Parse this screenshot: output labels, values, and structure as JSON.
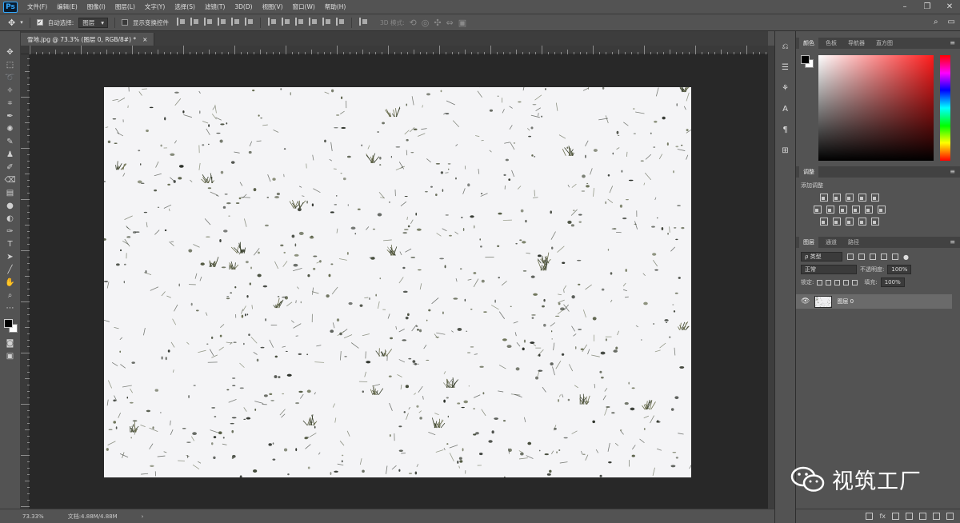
{
  "app": {
    "logo": "Ps",
    "menu": [
      "文件(F)",
      "编辑(E)",
      "图像(I)",
      "图层(L)",
      "文字(Y)",
      "选择(S)",
      "滤镜(T)",
      "3D(D)",
      "视图(V)",
      "窗口(W)",
      "帮助(H)"
    ]
  },
  "options": {
    "auto_select_label": "自动选择:",
    "auto_select_value": "图层",
    "transform_label": "显示变换控件",
    "mode_3d_label": "3D 模式:"
  },
  "document": {
    "tab_title": "雪地.jpg @ 73.3% (图层 0, RGB/8#) *",
    "tab_close": "×"
  },
  "status": {
    "zoom": "73.33%",
    "doc_size": "文档:4.88M/4.88M"
  },
  "panels": {
    "color_tabs": [
      "颜色",
      "色板",
      "导航器",
      "直方图"
    ],
    "adjust_tabs": [
      "调整"
    ],
    "adjust_title": "添加调整",
    "layers_tabs": [
      "图层",
      "通道",
      "路径"
    ],
    "layer_filter": "ρ 类型",
    "blend_mode": "正常",
    "opacity_label": "不透明度:",
    "opacity_value": "100%",
    "lock_label": "锁定:",
    "fill_label": "填充:",
    "fill_value": "100%",
    "layer_name": "图层 0"
  },
  "watermark": {
    "text": "视筑工厂"
  },
  "colors": {
    "foreground": "#000000",
    "background": "#ffffff",
    "selected_hue": "#ff1c1c"
  }
}
